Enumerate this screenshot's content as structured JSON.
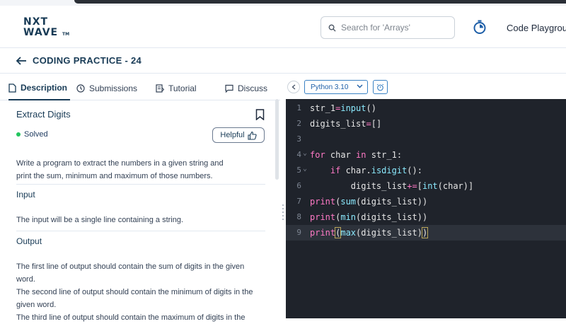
{
  "header": {
    "logo_top": "NXT",
    "logo_bottom": "WAVE",
    "logo_tm": "TM",
    "search_placeholder": "Search for 'Arrays'",
    "nav_link": "Code Playgrou"
  },
  "breadcrumb": {
    "title": "CODING PRACTICE - 24"
  },
  "tabs": [
    {
      "label": "Description",
      "icon": "document-icon",
      "active": true
    },
    {
      "label": "Submissions",
      "icon": "clock-icon",
      "active": false
    },
    {
      "label": "Tutorial",
      "icon": "tutorial-icon",
      "active": false
    },
    {
      "label": "Discuss",
      "icon": "chat-icon",
      "active": false
    }
  ],
  "problem": {
    "title": "Extract Digits",
    "status": "Solved",
    "helpful_label": "Helpful",
    "description_line1": "Write a program to extract the numbers in a given string and",
    "description_line2": "print the sum, minimum and maximum of those numbers.",
    "input_heading": "Input",
    "input_text": "The input will be a single line containing a string.",
    "output_heading": "Output",
    "output_l1": "The first line of output should contain the sum of digits in the given",
    "output_l2": "word.",
    "output_l3": "The second line of output should contain the minimum of digits in the",
    "output_l4": "given word.",
    "output_l5": "The third line of output should contain the maximum of digits in the"
  },
  "editor": {
    "language": "Python 3.10",
    "lines": [
      {
        "n": "1",
        "text": "str_1=input()"
      },
      {
        "n": "2",
        "text": "digits_list=[]"
      },
      {
        "n": "3",
        "text": ""
      },
      {
        "n": "4",
        "text": "for char in str_1:"
      },
      {
        "n": "5",
        "text": "    if char.isdigit():"
      },
      {
        "n": "6",
        "text": "        digits_list+=[int(char)]"
      },
      {
        "n": "7",
        "text": "print(sum(digits_list))"
      },
      {
        "n": "8",
        "text": "print(min(digits_list))"
      },
      {
        "n": "9",
        "text": "print(max(digits_list))"
      }
    ],
    "current_line": 9
  },
  "colors": {
    "brand": "#183b56",
    "editor_bg": "#1f232b",
    "keyword": "#ff79c6",
    "function": "#8be9fd",
    "solved": "#22c55e"
  }
}
